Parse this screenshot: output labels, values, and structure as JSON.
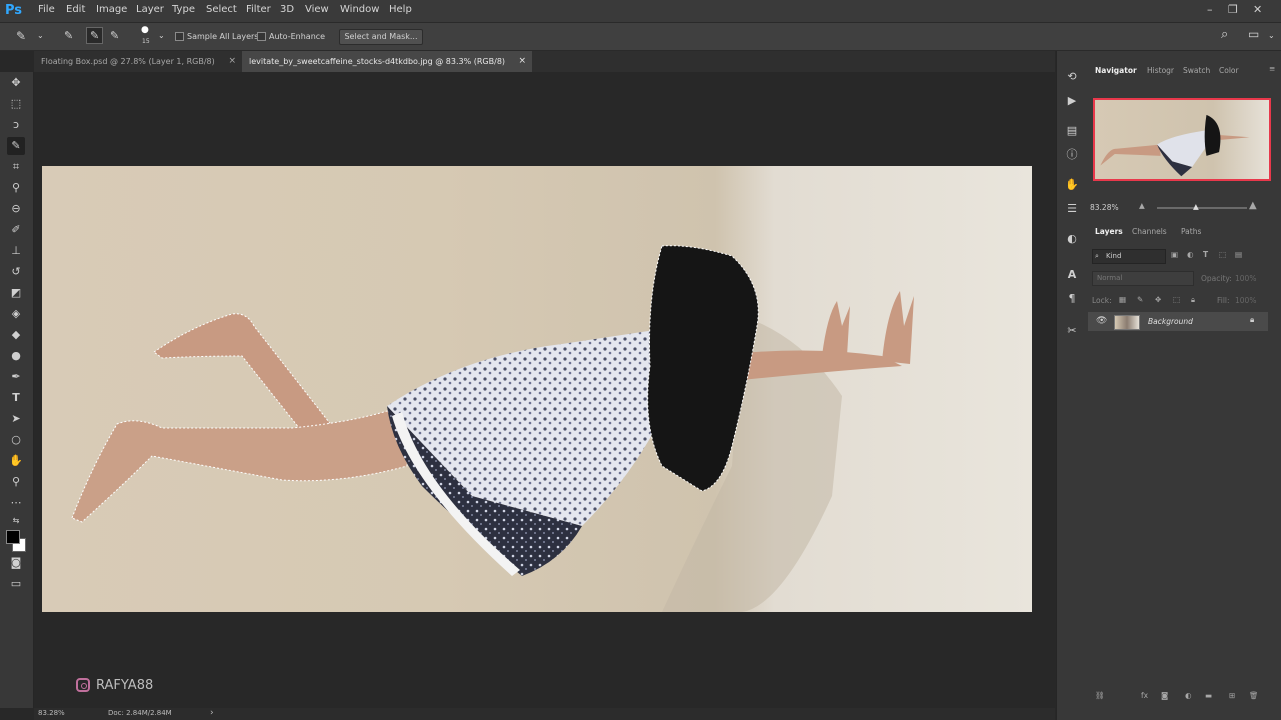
{
  "app": {
    "logo": "Ps"
  },
  "menu": [
    "File",
    "Edit",
    "Image",
    "Layer",
    "Type",
    "Select",
    "Filter",
    "3D",
    "View",
    "Window",
    "Help"
  ],
  "options": {
    "brush_size": "15",
    "sample_all_layers": "Sample All Layers",
    "auto_enhance": "Auto-Enhance",
    "select_and_mask": "Select and Mask..."
  },
  "tabs": [
    {
      "label": "Floating Box.psd @ 27.8% (Layer 1, RGB/8)",
      "close": "×"
    },
    {
      "label": "levitate_by_sweetcaffeine_stocks-d4tkdbo.jpg @ 83.3% (RGB/8)",
      "close": "×"
    }
  ],
  "watermark": "RAFYA88",
  "status": {
    "zoom": "83.28%",
    "doc": "Doc: 2.84M/2.84M",
    "arrow": "›"
  },
  "panels": {
    "top_tabs": [
      "Navigator",
      "Histogr",
      "Swatch",
      "Color"
    ],
    "nav_zoom": "83.28%",
    "layer_tabs": [
      "Layers",
      "Channels",
      "Paths"
    ],
    "kind": "Kind",
    "blend_mode": "Normal",
    "opacity_label": "Opacity:",
    "opacity_value": "100%",
    "lock_label": "Lock:",
    "fill_label": "Fill:",
    "fill_value": "100%",
    "layer_name": "Background"
  },
  "colors": {
    "accent": "#31a8ff",
    "nav_frame": "#e8384b"
  }
}
